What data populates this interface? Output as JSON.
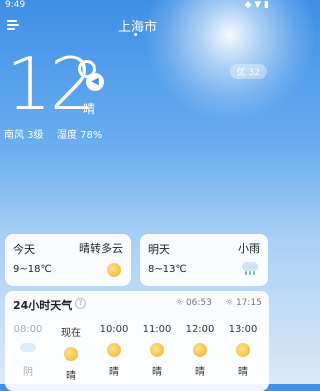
{
  "status": {
    "time": "9:49",
    "icons": "◆ ▼ ▮"
  },
  "header": {
    "city": "上海市"
  },
  "current": {
    "temperature": "12",
    "condition": "晴",
    "aqi": "优 32",
    "wind": "南风 3级",
    "humidity": "湿度 78%"
  },
  "today": {
    "label": "今天",
    "desc": "晴转多云",
    "range": "9~18℃",
    "icon": "sun-icon"
  },
  "tomorrow": {
    "label": "明天",
    "desc": "小雨",
    "range": "8~13℃",
    "icon": "light-rain-icon"
  },
  "hourly": {
    "title": "24小时天气",
    "help": "?",
    "sunrise": "06:53",
    "sunset": "17:15",
    "hours": [
      {
        "time": "08:00",
        "weather": "阴",
        "icon": "overcast-icon",
        "past": true
      },
      {
        "time": "现在",
        "weather": "晴",
        "icon": "sun-icon",
        "past": false
      },
      {
        "time": "10:00",
        "weather": "晴",
        "icon": "sun-icon",
        "past": false
      },
      {
        "time": "11:00",
        "weather": "晴",
        "icon": "sun-icon",
        "past": false
      },
      {
        "time": "12:00",
        "weather": "晴",
        "icon": "sun-icon",
        "past": false
      },
      {
        "time": "13:00",
        "weather": "晴",
        "icon": "sun-icon",
        "past": false
      }
    ]
  },
  "colors": {
    "sky_top": "#3f8fe6",
    "card_bg": "#ffffff",
    "sun": "#f2b12a"
  }
}
